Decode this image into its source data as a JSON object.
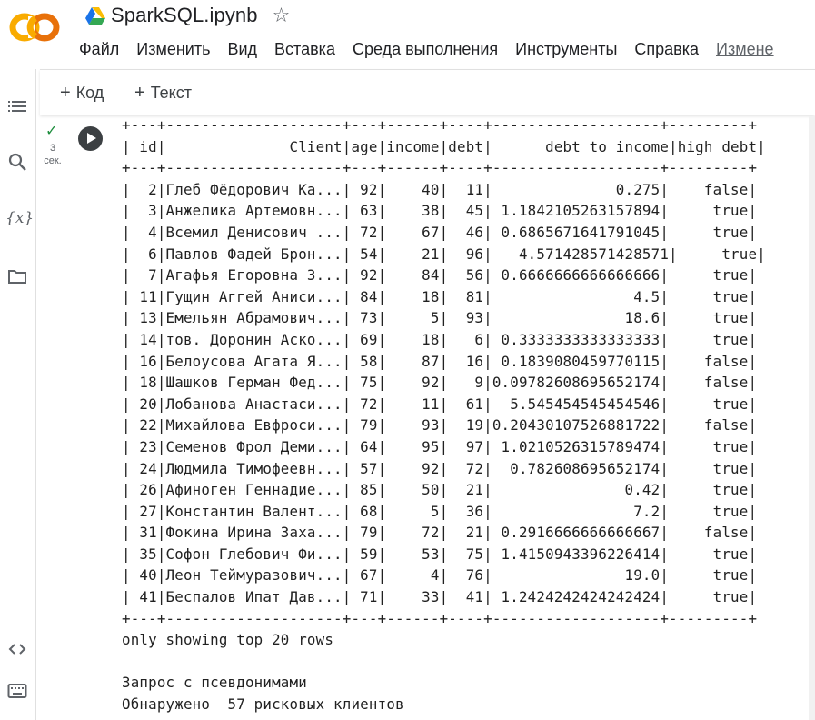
{
  "header": {
    "title": "SparkSQL.ipynb",
    "menu": [
      "Файл",
      "Изменить",
      "Вид",
      "Вставка",
      "Среда выполнения",
      "Инструменты",
      "Справка",
      "Измене"
    ]
  },
  "toolbar": {
    "add_code": "Код",
    "add_text": "Текст"
  },
  "cell": {
    "exec_count": "3",
    "exec_unit": "сек."
  },
  "output": {
    "border": "+---+--------------------+---+------+----+-------------------+---------+",
    "header_line": "| id|              Client|age|income|debt|      debt_to_income|high_debt|",
    "rows": [
      "|  2|Глеб Фёдорович Ка...| 92|    40|  11|              0.275|    false|",
      "|  3|Анжелика Артемовн...| 63|    38|  45| 1.1842105263157894|     true|",
      "|  4|Всемил Денисович ...| 72|    67|  46| 0.6865671641791045|     true|",
      "|  6|Павлов Фадей Брон...| 54|    21|  96|   4.571428571428571|     true|",
      "|  7|Агафья Егоровна З...| 92|    84|  56| 0.6666666666666666|     true|",
      "| 11|Гущин Аггей Аниси...| 84|    18|  81|                4.5|     true|",
      "| 13|Емельян Абрамович...| 73|     5|  93|               18.6|     true|",
      "| 14|тов. Доронин Аско...| 69|    18|   6| 0.3333333333333333|     true|",
      "| 16|Белоусова Агата Я...| 58|    87|  16| 0.1839080459770115|    false|",
      "| 18|Шашков Герман Фед...| 75|    92|   9|0.09782608695652174|    false|",
      "| 20|Лобанова Анастаси...| 72|    11|  61|  5.545454545454546|     true|",
      "| 22|Михайлова Евфроси...| 79|    93|  19|0.20430107526881722|    false|",
      "| 23|Семенов Фрол Деми...| 64|    95|  97| 1.0210526315789474|     true|",
      "| 24|Людмила Тимофеевн...| 57|    92|  72|  0.782608695652174|     true|",
      "| 26|Афиноген Геннадие...| 85|    50|  21|               0.42|     true|",
      "| 27|Константин Валент...| 68|     5|  36|                7.2|     true|",
      "| 31|Фокина Ирина Заха...| 79|    72|  21| 0.2916666666666667|    false|",
      "| 35|Софон Глебович Фи...| 59|    53|  75| 1.4150943396226414|     true|",
      "| 40|Леон Теймуразович...| 67|     4|  76|               19.0|     true|",
      "| 41|Беспалов Ипат Дав...| 71|    33|  41| 1.2424242424242424|     true|"
    ],
    "footer": "only showing top 20 rows",
    "line_query": "Запрос с псевдонимами",
    "line_found": "Обнаружено  57 рисковых клиентов"
  }
}
